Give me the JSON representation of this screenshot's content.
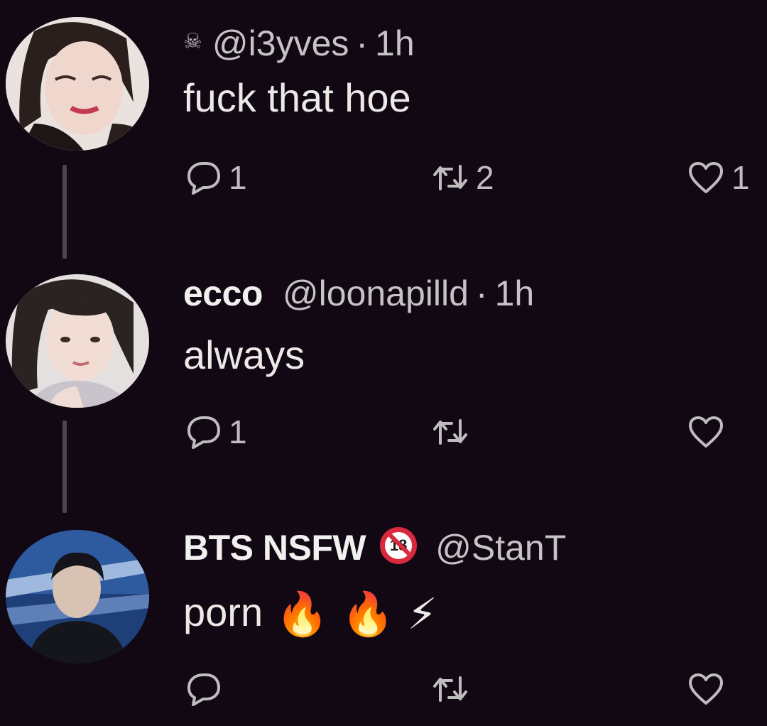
{
  "tweets": [
    {
      "display_name": "",
      "handle": "@i3yves",
      "time": "1h",
      "text": "fuck that hoe",
      "reply_count": "1",
      "retweet_count": "2",
      "like_count": "1",
      "icon": "skull-crossbones-icon"
    },
    {
      "display_name": "ecco",
      "handle": "@loonapilld",
      "time": "1h",
      "text": "always",
      "reply_count": "1",
      "retweet_count": "",
      "like_count": ""
    },
    {
      "display_name": "BTS NSFW",
      "badge": "18",
      "handle": "@StanT",
      "time": "",
      "text": "porn",
      "emojis": [
        "🔥",
        "🔥",
        "⚡"
      ],
      "reply_count": "",
      "retweet_count": "",
      "like_count": ""
    }
  ],
  "separator": "·",
  "colors": {
    "background": "#120813",
    "text": "#eceae8",
    "secondary": "#c6c3c6",
    "thread_line": "#4a4550",
    "badge_red": "#d9293c"
  }
}
